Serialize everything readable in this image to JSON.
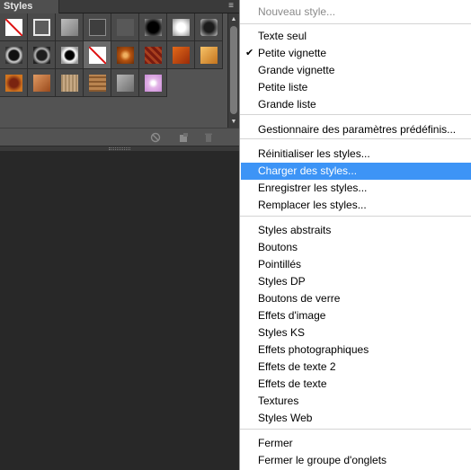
{
  "panel": {
    "tab_label": "Styles",
    "menu_button": "≡",
    "scroll_up": "▲",
    "scroll_down": "▼",
    "swatches": [
      {
        "kind": "none"
      },
      {
        "kind": "square-outline"
      },
      {
        "kind": "gray-bevel"
      },
      {
        "kind": "dark-inset"
      },
      {
        "kind": "flat-gray"
      },
      {
        "kind": "black-glow"
      },
      {
        "kind": "white-glow"
      },
      {
        "kind": "dark-bevel"
      },
      {
        "kind": "black-ring"
      },
      {
        "kind": "dark-ring"
      },
      {
        "kind": "white-ring"
      },
      {
        "kind": "none-selected"
      },
      {
        "kind": "orange-dot"
      },
      {
        "kind": "rust-texture"
      },
      {
        "kind": "red-orange"
      },
      {
        "kind": "gold"
      },
      {
        "kind": "rust-square"
      },
      {
        "kind": "copper"
      },
      {
        "kind": "tan-texture"
      },
      {
        "kind": "wood"
      },
      {
        "kind": "gray-bevel-light"
      },
      {
        "kind": "pink-sparkle"
      }
    ],
    "footer_icons": [
      "clear-style-icon",
      "new-style-icon",
      "delete-icon"
    ]
  },
  "menu": {
    "items": [
      {
        "label": "Nouveau style...",
        "disabled": true
      },
      {
        "label": "Texte seul"
      },
      {
        "label": "Petite vignette",
        "checked": true
      },
      {
        "label": "Grande vignette"
      },
      {
        "label": "Petite liste"
      },
      {
        "label": "Grande liste"
      },
      {
        "label": "Gestionnaire des paramètres prédéfinis..."
      },
      {
        "label": "Réinitialiser les styles..."
      },
      {
        "label": "Charger des styles...",
        "highlighted": true
      },
      {
        "label": "Enregistrer les styles..."
      },
      {
        "label": "Remplacer les styles..."
      },
      {
        "label": "Styles abstraits"
      },
      {
        "label": "Boutons"
      },
      {
        "label": "Pointillés"
      },
      {
        "label": "Styles DP"
      },
      {
        "label": "Boutons de verre"
      },
      {
        "label": "Effets d'image"
      },
      {
        "label": "Styles KS"
      },
      {
        "label": "Effets photographiques"
      },
      {
        "label": "Effets de texte 2"
      },
      {
        "label": "Effets de texte"
      },
      {
        "label": "Textures"
      },
      {
        "label": "Styles Web"
      },
      {
        "label": "Fermer"
      },
      {
        "label": "Fermer le groupe d'onglets"
      }
    ],
    "check_mark": "✔"
  },
  "colors": {
    "highlight": "#3d94f6",
    "panel_bg": "#535353",
    "canvas_bg": "#282828"
  }
}
